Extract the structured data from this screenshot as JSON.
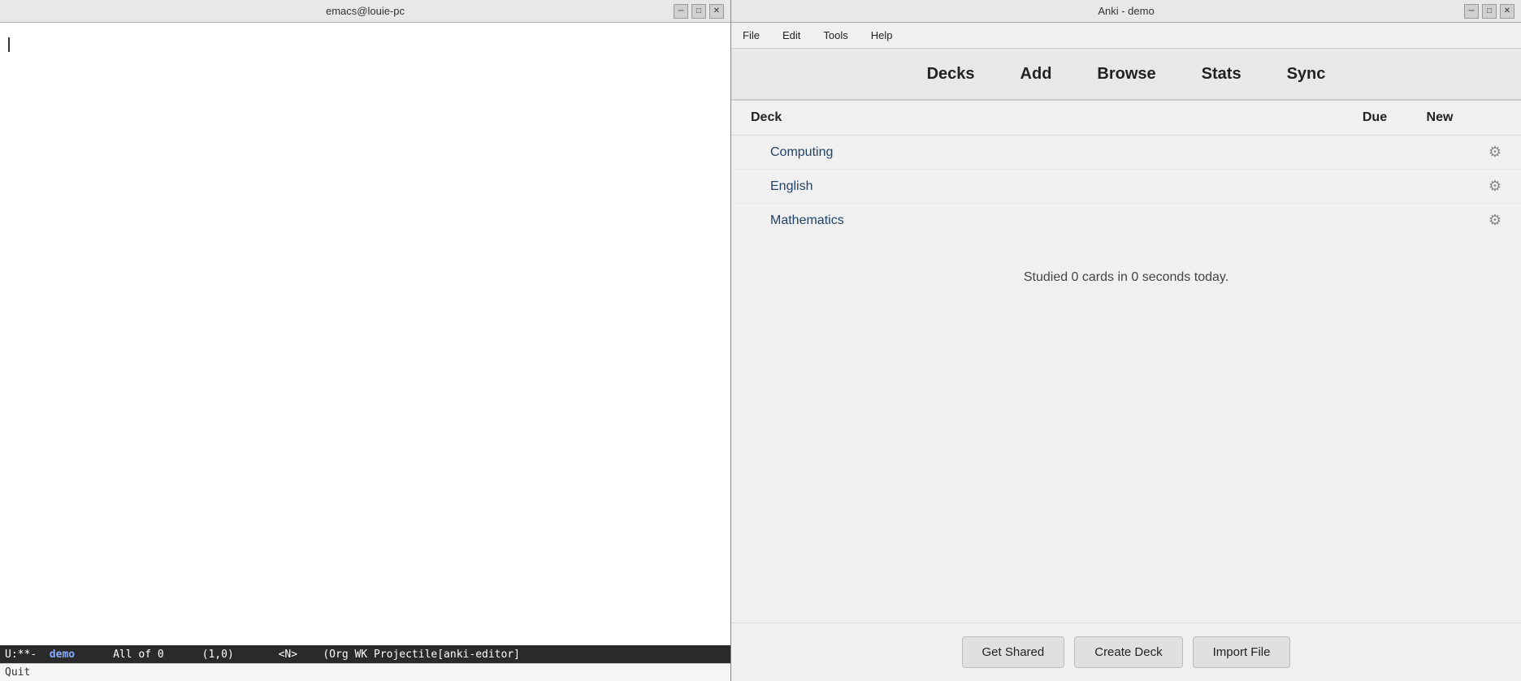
{
  "emacs": {
    "title": "emacs@louie-pc",
    "statusbar": {
      "prefix": "U:**-  ",
      "demo": "demo",
      "rest": "      All of 0      (1,0)       <N>    (Org WK Projectile[anki-editor]"
    },
    "minibuffer": "Quit",
    "controls": {
      "minimize": "─",
      "maximize": "□",
      "close": "✕"
    }
  },
  "anki": {
    "title": "Anki - demo",
    "controls": {
      "minimize": "─",
      "maximize": "□",
      "close": "✕"
    },
    "menu": {
      "items": [
        "File",
        "Edit",
        "Tools",
        "Help"
      ]
    },
    "toolbar": {
      "buttons": [
        "Decks",
        "Add",
        "Browse",
        "Stats",
        "Sync"
      ]
    },
    "deck_list": {
      "headers": {
        "deck": "Deck",
        "due": "Due",
        "new": "New"
      },
      "decks": [
        {
          "name": "Computing",
          "due": "",
          "new": ""
        },
        {
          "name": "English",
          "due": "",
          "new": ""
        },
        {
          "name": "Mathematics",
          "due": "",
          "new": ""
        }
      ]
    },
    "studied_text": "Studied 0 cards in 0 seconds today.",
    "footer": {
      "buttons": [
        "Get Shared",
        "Create Deck",
        "Import File"
      ]
    }
  }
}
